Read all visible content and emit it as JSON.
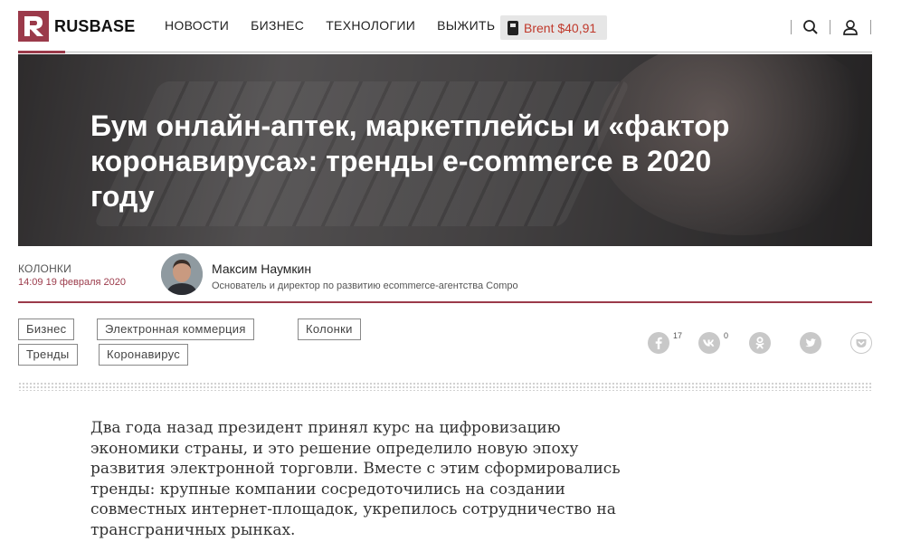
{
  "header": {
    "logo_text": "RUSBASE",
    "nav": [
      "НОВОСТИ",
      "БИЗНЕС",
      "ТЕХНОЛОГИИ",
      "ВЫЖИТЬ"
    ],
    "brent_label": "Brent $40,91",
    "icons": [
      "search-icon",
      "user-icon"
    ],
    "accent_color": "#9b3a4a"
  },
  "hero": {
    "title": "Бум онлайн-аптек, маркетплейсы и «фактор коронавируса»: тренды e-commerce в 2020 году"
  },
  "meta": {
    "rubric": "КОЛОНКИ",
    "date": "14:09 19 февраля 2020",
    "author_name": "Максим Наумкин",
    "author_role": "Основатель и директор по развитию ecommerce-агентства Compo"
  },
  "tags": [
    "Бизнес",
    "Электронная коммерция",
    "Колонки",
    "Тренды",
    "Коронавирус"
  ],
  "share": {
    "facebook_count": "17",
    "vk_count": "0",
    "icons": [
      "facebook-icon",
      "vk-icon",
      "odnoklassniki-icon",
      "twitter-icon",
      "pocket-icon"
    ]
  },
  "article": {
    "lead": "Два года назад президент принял курс на цифровизацию экономики страны, и это решение определило новую эпоху развития электронной торговли. Вместе с этим сформировались тренды: крупные компании сосредоточились на создании совместных интернет-площадок, укрепилось сотрудничество на трансграничных рынках."
  }
}
